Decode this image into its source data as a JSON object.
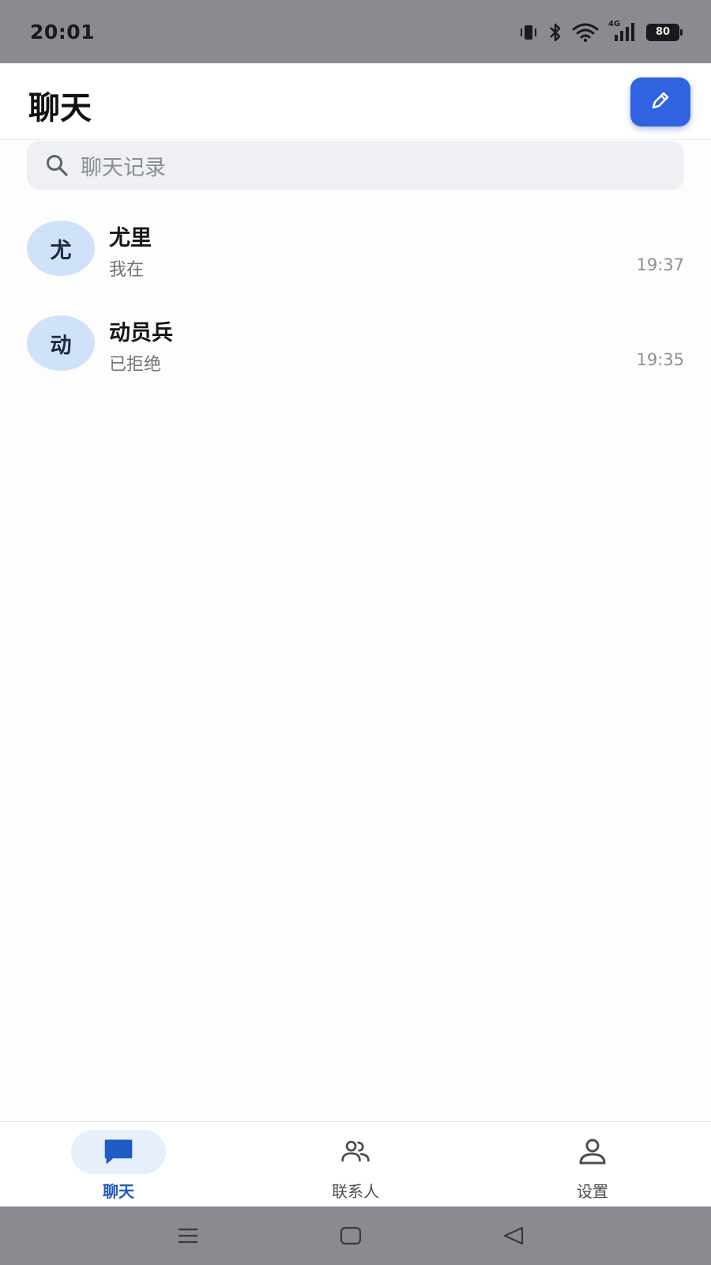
{
  "status_bar": {
    "time": "20:01",
    "battery": "80",
    "network": "4G",
    "icons": [
      "vibrate-icon",
      "bluetooth-icon",
      "wifi-icon",
      "signal-icon",
      "battery-icon"
    ]
  },
  "header": {
    "title": "聊天",
    "compose_icon": "pencil-icon",
    "accent_color": "#2f63e0"
  },
  "search": {
    "placeholder": "聊天记录",
    "icon": "search-icon"
  },
  "chats": [
    {
      "avatar": "尤",
      "name": "尤里",
      "preview": "我在",
      "time": "19:37"
    },
    {
      "avatar": "动",
      "name": "动员兵",
      "preview": "已拒绝",
      "time": "19:35"
    }
  ],
  "bottom_nav": {
    "items": [
      {
        "label": "聊天",
        "icon": "chat-bubble-icon",
        "active": true
      },
      {
        "label": "联系人",
        "icon": "contacts-icon",
        "active": false
      },
      {
        "label": "设置",
        "icon": "person-icon",
        "active": false
      }
    ],
    "active_color": "#2057c8"
  },
  "system_nav": {
    "icons": [
      "menu-icon",
      "home-icon",
      "back-icon"
    ]
  }
}
